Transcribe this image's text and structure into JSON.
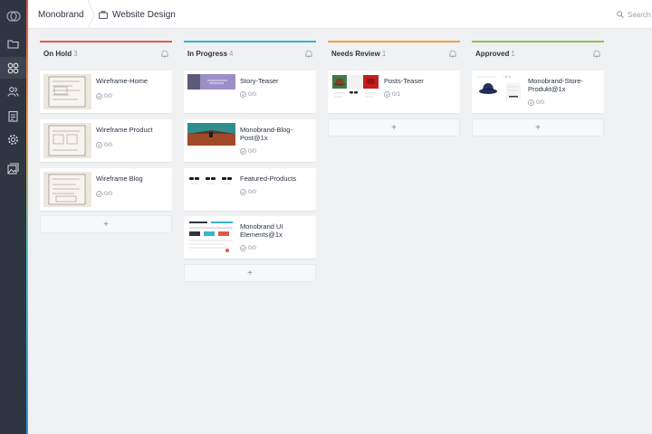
{
  "app": {
    "accent": "#2e3641"
  },
  "breadcrumb": {
    "workspace": "Monobrand",
    "project": "Website Design"
  },
  "search": {
    "placeholder": "Search"
  },
  "sidebar": {
    "items": [
      {
        "icon": "folder-icon",
        "name": "projects"
      },
      {
        "icon": "apps-icon",
        "name": "boards",
        "active": true
      },
      {
        "icon": "users-icon",
        "name": "team"
      },
      {
        "icon": "clipboard-icon",
        "name": "tasks"
      },
      {
        "icon": "gear-icon",
        "name": "settings"
      },
      {
        "icon": "image-stack-icon",
        "name": "assets"
      }
    ]
  },
  "columns": [
    {
      "title": "On Hold",
      "count": "3",
      "color": "#e05a47",
      "cards": [
        {
          "title": "Wireframe-Home",
          "meta": "0/0"
        },
        {
          "title": "Wireframe Product",
          "meta": "0/0"
        },
        {
          "title": "Wireframe Blog",
          "meta": "0/0"
        }
      ],
      "add_label": "+"
    },
    {
      "title": "In Progress",
      "count": "4",
      "color": "#36b5c9",
      "cards": [
        {
          "title": "Story-Teaser",
          "meta": "0/0"
        },
        {
          "title": "Monobrand-Blog-Post@1x",
          "meta": "0/0"
        },
        {
          "title": "Featured-Products",
          "meta": "0/0"
        },
        {
          "title": "Monobrand UI Elements@1x",
          "meta": "0/0"
        }
      ],
      "add_label": "+"
    },
    {
      "title": "Needs Review",
      "count": "1",
      "color": "#f0a13c",
      "cards": [
        {
          "title": "Posts-Teaser",
          "meta": "0/1"
        }
      ],
      "add_label": "+"
    },
    {
      "title": "Approved",
      "count": "1",
      "color": "#8cc152",
      "cards": [
        {
          "title": "Monobrand-Store-Produkt@1x",
          "meta": "0/0"
        }
      ],
      "add_label": "+"
    }
  ]
}
